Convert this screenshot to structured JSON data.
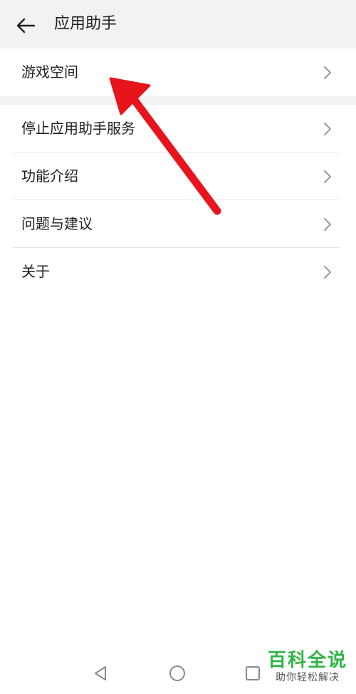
{
  "header": {
    "title": "应用助手",
    "back_icon": "arrow-left-icon"
  },
  "game_space": {
    "label": "游戏空间"
  },
  "menu": {
    "items": [
      {
        "label": "停止应用助手服务"
      },
      {
        "label": "功能介绍"
      },
      {
        "label": "问题与建议"
      },
      {
        "label": "关于"
      }
    ]
  },
  "annotation": {
    "arrow_color": "#e8141b"
  },
  "navbar": {
    "icons": [
      "back-triangle-icon",
      "home-circle-icon",
      "recent-square-icon"
    ]
  },
  "watermark": {
    "title": "百科全说",
    "subtitle": "助你轻松解决"
  },
  "colors": {
    "header_bg": "#f2f1f3",
    "text": "#1f1f1f",
    "chevron": "#9a9a9a",
    "divider": "#e6e6e6",
    "brand": "#2fb545"
  }
}
